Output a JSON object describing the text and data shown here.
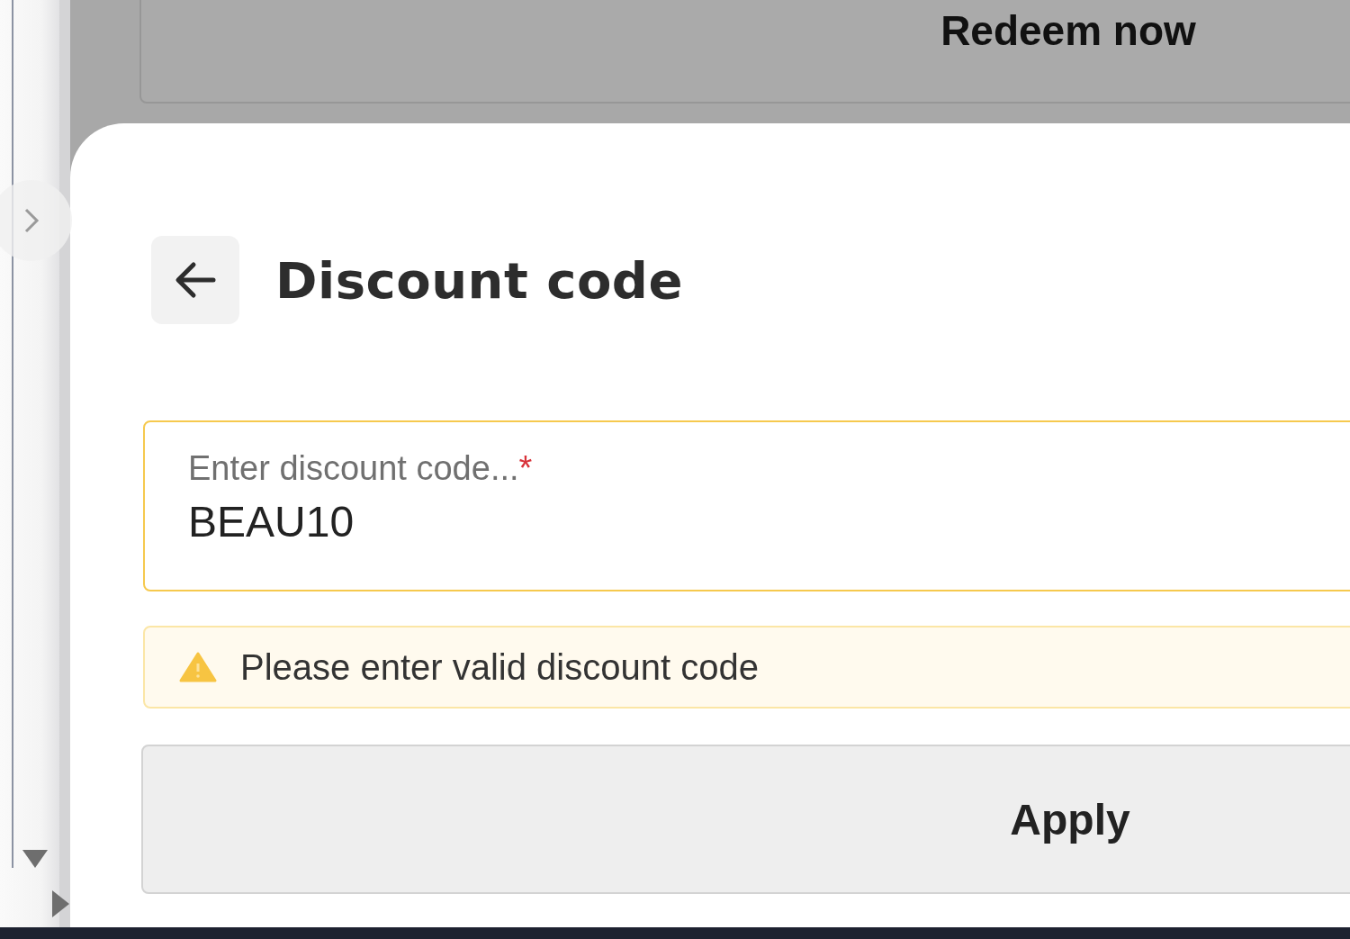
{
  "background_button": {
    "label": "Redeem now"
  },
  "sheet": {
    "title": "Discount code",
    "field": {
      "label": "Enter discount code...",
      "required_mark": "*",
      "value": "BEAU10",
      "invalid": true
    },
    "alert": {
      "message": "Please enter valid discount code"
    },
    "apply_button": {
      "label": "Apply"
    }
  }
}
